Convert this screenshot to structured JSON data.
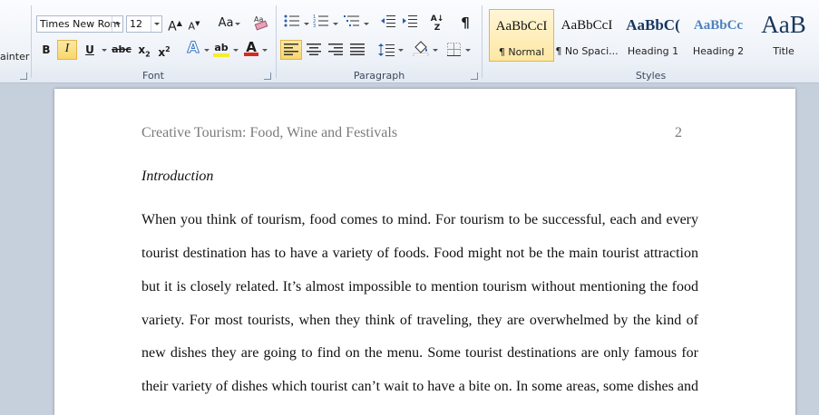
{
  "ribbon": {
    "clipboard": {
      "painter_label": "ainter"
    },
    "font": {
      "label": "Font",
      "font_name": "Times New Rom",
      "font_size": "12",
      "grow": "A",
      "shrink": "A",
      "change_case": "Aa",
      "bold": "B",
      "italic": "I",
      "underline": "U",
      "strike": "abc",
      "subscript": "x",
      "superscript": "x",
      "subscript_mark": "2",
      "superscript_mark": "2",
      "text_effects": "A",
      "highlight": "ab",
      "font_color": "A",
      "highlight_color": "#f5ee2f",
      "font_color_bar": "#d52b1e"
    },
    "paragraph": {
      "label": "Paragraph",
      "pilcrow": "¶",
      "sort": "A↓Z"
    },
    "styles": {
      "label": "Styles",
      "items": [
        {
          "preview": "AaBbCcI",
          "name": "¶ Normal"
        },
        {
          "preview": "AaBbCcI",
          "name": "¶ No Spaci..."
        },
        {
          "preview": "AaBbC(",
          "name": "Heading 1"
        },
        {
          "preview": "AaBbCc",
          "name": "Heading 2"
        },
        {
          "preview": "AaB",
          "name": "Title"
        }
      ]
    }
  },
  "document": {
    "header_title": "Creative Tourism:  Food, Wine and Festivals",
    "page_number": "2",
    "heading": "Introduction",
    "lines": [
      "When you think of tourism, food comes to mind. For tourism to be successful, each and every",
      "tourist destination has to have a variety of foods. Food might not be the main tourist attraction",
      "but it is closely related. It’s almost impossible to mention tourism without mentioning the food",
      "variety. For most tourists, when they think of traveling, they are overwhelmed by the kind of",
      "new dishes they are going to find on the menu. Some tourist destinations are only famous for",
      "their variety of dishes which tourist can’t wait to have a bite on. In some areas, some dishes and"
    ]
  }
}
